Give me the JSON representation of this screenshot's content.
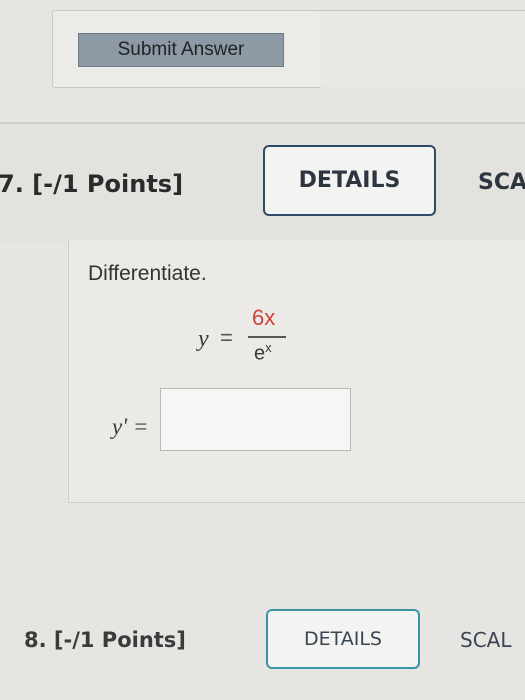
{
  "previous_question": {
    "submit_label": "Submit Answer"
  },
  "question7": {
    "number_label": "7. [-/1 Points]",
    "details_label": "DETAILS",
    "scale_label": "SCA",
    "prompt": "Differentiate.",
    "equation": {
      "lhs": "y",
      "equals": "=",
      "numerator": "6x",
      "denominator_base": "e",
      "denominator_exponent": "x"
    },
    "answer_label": "y' =",
    "answer_value": ""
  },
  "question8": {
    "number_label": "8. [-/1 Points]",
    "details_label": "DETAILS",
    "scale_label": "SCAL"
  },
  "colors": {
    "numerator": "#c9463a",
    "details_border": "#2f4a66",
    "q8_details_border": "#3b93a8",
    "submit_button": "#8d9aa6"
  }
}
